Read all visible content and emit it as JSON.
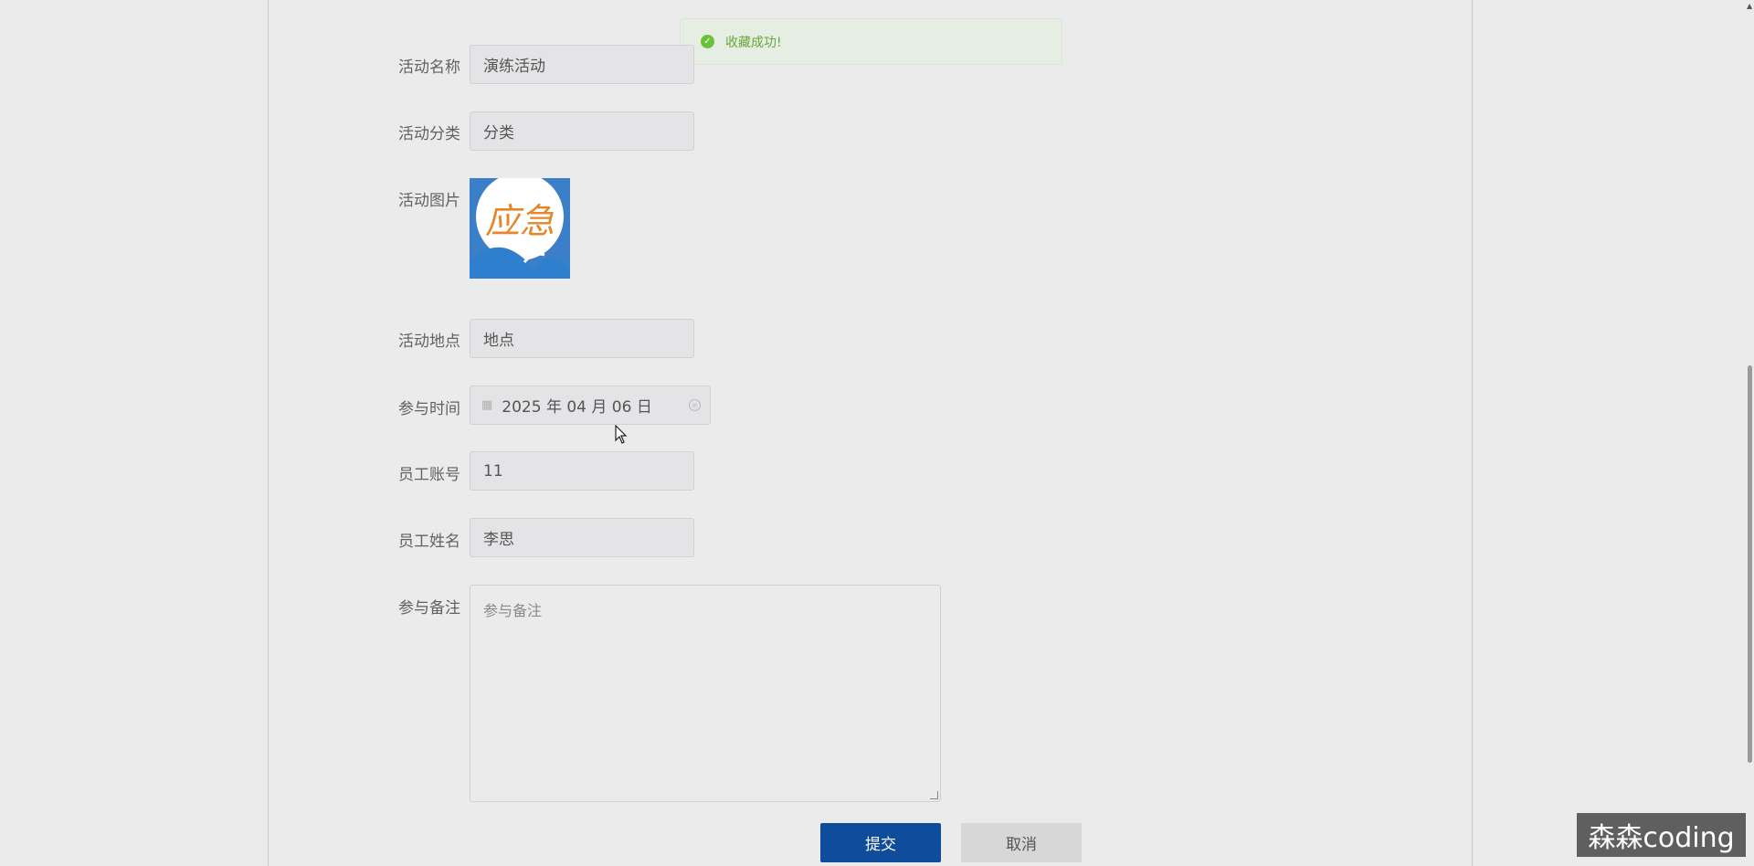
{
  "toast": {
    "message": "收藏成功!",
    "icon": "check-circle-icon"
  },
  "form": {
    "activity_name": {
      "label": "活动名称",
      "value": "演练活动"
    },
    "activity_category": {
      "label": "活动分类",
      "value": "分类"
    },
    "activity_image": {
      "label": "活动图片",
      "image_text": "应急"
    },
    "activity_location": {
      "label": "活动地点",
      "value": "地点"
    },
    "participation_time": {
      "label": "参与时间",
      "value": "2025 年 04 月 06 日"
    },
    "employee_account": {
      "label": "员工账号",
      "value": "11"
    },
    "employee_name": {
      "label": "员工姓名",
      "value": "李思"
    },
    "participation_note": {
      "label": "参与备注",
      "placeholder": "参与备注"
    }
  },
  "buttons": {
    "submit": "提交",
    "cancel": "取消"
  },
  "watermark": "森森coding",
  "colors": {
    "primary": "#0f4c9b",
    "success": "#67c23a",
    "logo_orange": "#e5862a",
    "logo_blue": "#2f7fcf"
  }
}
